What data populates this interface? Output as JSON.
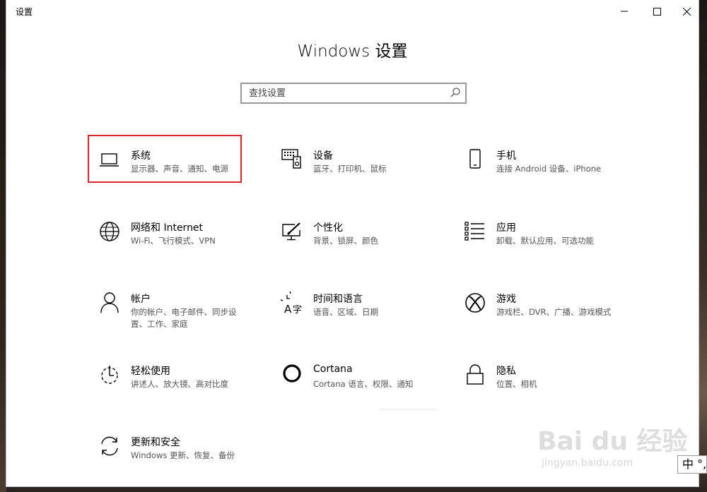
{
  "window": {
    "title": "设置",
    "controls": {
      "minimize_icon": "minimize-icon",
      "maximize_icon": "maximize-icon",
      "close_icon": "close-icon"
    }
  },
  "header": {
    "title": "Windows 设置"
  },
  "search": {
    "placeholder": "查找设置",
    "value": "",
    "icon": "search-icon"
  },
  "tiles": [
    {
      "name": "系统",
      "desc": "显示器、声音、通知、电源",
      "icon": "laptop-icon",
      "highlighted": true
    },
    {
      "name": "设备",
      "desc": "蓝牙、打印机、鼠标",
      "icon": "keyboard-speaker-icon"
    },
    {
      "name": "手机",
      "desc": "连接 Android 设备、iPhone",
      "icon": "phone-icon"
    },
    {
      "name": "网络和 Internet",
      "desc": "Wi-Fi、飞行模式、VPN",
      "icon": "globe-icon"
    },
    {
      "name": "个性化",
      "desc": "背景、锁屏、颜色",
      "icon": "paint-monitor-icon"
    },
    {
      "name": "应用",
      "desc": "卸载、默认应用、可选功能",
      "icon": "app-list-icon"
    },
    {
      "name": "帐户",
      "desc": "你的帐户、电子邮件、同步设置、工作、家庭",
      "icon": "person-icon"
    },
    {
      "name": "时间和语言",
      "desc": "语音、区域、日期",
      "icon": "time-language-icon"
    },
    {
      "name": "游戏",
      "desc": "游戏栏、DVR、广播、游戏模式",
      "icon": "xbox-icon"
    },
    {
      "name": "轻松使用",
      "desc": "讲述人、放大镜、高对比度",
      "icon": "ease-of-access-icon"
    },
    {
      "name": "Cortana",
      "desc": "Cortana 语言、权限、通知",
      "icon": "cortana-icon"
    },
    {
      "name": "隐私",
      "desc": "位置、相机",
      "icon": "lock-icon"
    },
    {
      "name": "更新和安全",
      "desc": "Windows 更新、恢复、备份",
      "icon": "sync-icon"
    }
  ],
  "colors": {
    "highlight_border": "#e0262a",
    "text": "#000000",
    "desc_text": "#555555"
  },
  "watermark": {
    "logo": "Bai du 经验",
    "url": "jingyan.baidu.com"
  },
  "ime": {
    "label": "中 °,"
  }
}
